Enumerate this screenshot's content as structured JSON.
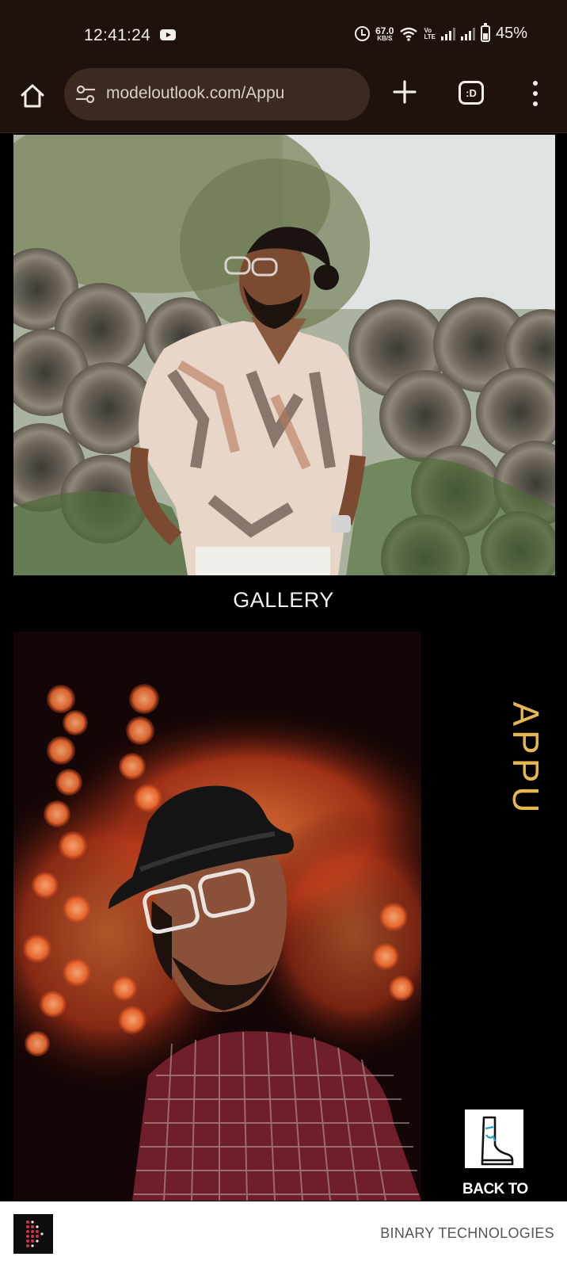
{
  "status_bar": {
    "time": "12:41:24",
    "net_speed_value": "67.0",
    "net_speed_unit": "KB/S",
    "volte_top": "Vo",
    "volte_bottom": "LTE",
    "battery": "45%"
  },
  "browser": {
    "url": "modeloutlook.com/Appu",
    "tab_icon_label": ":D"
  },
  "page": {
    "gallery_heading": "GALLERY",
    "model_name": "APPU",
    "back_label": "BACK TO"
  },
  "footer": {
    "brand": "BINARY TECHNOLOGIES"
  },
  "colors": {
    "status_bar_bg": "#1f120c",
    "url_bar_bg": "#3a2a1f",
    "accent_name": "#e5b74e"
  },
  "icons": {
    "home": "home-icon",
    "site_settings": "tune-icon",
    "new_tab": "plus-icon",
    "tabs": "tab-switcher-icon",
    "menu": "kebab-menu-icon",
    "back": "boot-icon"
  }
}
